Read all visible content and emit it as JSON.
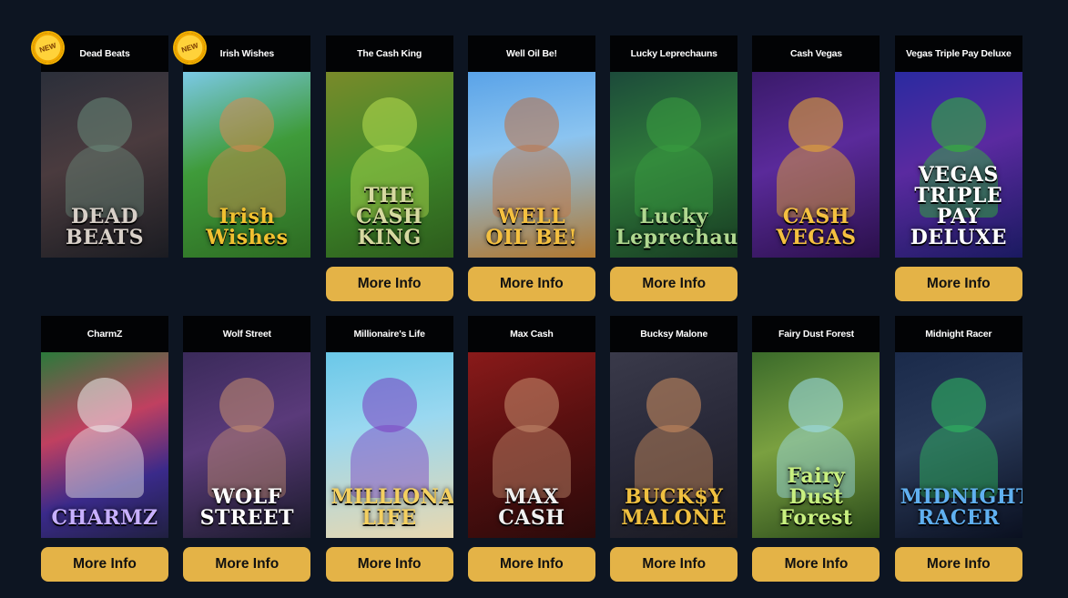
{
  "badge_label": "NEW",
  "button_label": "More Info",
  "games": [
    {
      "title": "Dead Beats",
      "logo": "DEAD BEATS",
      "new": true,
      "has_button": false,
      "bg": "linear-gradient(160deg,#2b2f3a,#4a3b3e 45%,#1b1c22)",
      "logo_color": "#d8d0c8",
      "accent": "#6a8a7a"
    },
    {
      "title": "Irish Wishes",
      "logo": "Irish Wishes",
      "new": true,
      "has_button": false,
      "bg": "linear-gradient(160deg,#7bc9e6,#3f9b3a 45%,#2d6a22)",
      "logo_color": "#f0c030",
      "accent": "#d88850"
    },
    {
      "title": "The Cash King",
      "logo": "THE CASH KING",
      "new": false,
      "has_button": true,
      "bg": "linear-gradient(160deg,#7a8a2a,#3e8a2a 50%,#2d5b1c)",
      "logo_color": "#d6d9a0",
      "accent": "#b8e050"
    },
    {
      "title": "Well Oil Be!",
      "logo": "WELL OIL BE!",
      "new": false,
      "has_button": true,
      "bg": "linear-gradient(170deg,#5aa3e8,#8bc4f0 40%,#b07830)",
      "logo_color": "#f4c040",
      "accent": "#c07040"
    },
    {
      "title": "Lucky Leprechauns",
      "logo": "Lucky Leprechauns",
      "new": false,
      "has_button": true,
      "bg": "linear-gradient(160deg,#1c4a3a,#2f7a3a 45%,#173a22)",
      "logo_color": "#b0d890",
      "accent": "#3aa040"
    },
    {
      "title": "Cash Vegas",
      "logo": "CASH VEGAS",
      "new": false,
      "has_button": false,
      "bg": "linear-gradient(160deg,#3a1a6a,#5a2a9a 45%,#2a104a)",
      "logo_color": "#f4c040",
      "accent": "#f0b030"
    },
    {
      "title": "Vegas Triple Pay Deluxe",
      "logo": "VEGAS TRIPLE PAY DELUXE",
      "new": false,
      "has_button": true,
      "bg": "linear-gradient(160deg,#2a2aa0,#5a2aa0 45%,#1a1a60)",
      "logo_color": "#ffffff",
      "accent": "#30c030"
    },
    {
      "title": "CharmZ",
      "logo": "CHARMZ",
      "new": false,
      "has_button": true,
      "bg": "linear-gradient(160deg,#2a7a3a,#c04060 40%,#3a2a8a 70%,#202040)",
      "logo_color": "#c8b0ff",
      "accent": "#f0f0f0"
    },
    {
      "title": "Wolf Street",
      "logo": "WOLF STREET",
      "new": false,
      "has_button": true,
      "bg": "linear-gradient(160deg,#3a2a5a,#5a3a7a 45%,#1a1a2a)",
      "logo_color": "#ffffff",
      "accent": "#c89070"
    },
    {
      "title": "Millionaire's Life",
      "logo": "MILLIONAIRE'S LIFE",
      "new": false,
      "has_button": true,
      "bg": "linear-gradient(170deg,#6ac8e8,#9ad8f0 40%,#e8d8b0)",
      "logo_color": "#f4d060",
      "accent": "#7a3ac0"
    },
    {
      "title": "Max Cash",
      "logo": "MAX CASH",
      "new": false,
      "has_button": true,
      "bg": "linear-gradient(160deg,#8a1a1a,#5a1010 45%,#2a0a0a)",
      "logo_color": "#f0f0f0",
      "accent": "#c89070"
    },
    {
      "title": "Bucksy Malone",
      "logo": "BUCK$Y MALONE",
      "new": false,
      "has_button": true,
      "bg": "linear-gradient(160deg,#3a3a4a,#2a2a3a 45%,#1a1a22)",
      "logo_color": "#f0c040",
      "accent": "#d09060"
    },
    {
      "title": "Fairy Dust Forest",
      "logo": "Fairy Dust Forest",
      "new": false,
      "has_button": true,
      "bg": "linear-gradient(160deg,#3a6a2a,#7aa040 45%,#2a4a1a)",
      "logo_color": "#c8f080",
      "accent": "#a0e0f0"
    },
    {
      "title": "Midnight Racer",
      "logo": "MIDNIGHT RACER",
      "new": false,
      "has_button": true,
      "bg": "linear-gradient(160deg,#1a2a4a,#2a3a5a 45%,#0a1020)",
      "logo_color": "#60b0f0",
      "accent": "#30c060"
    }
  ]
}
